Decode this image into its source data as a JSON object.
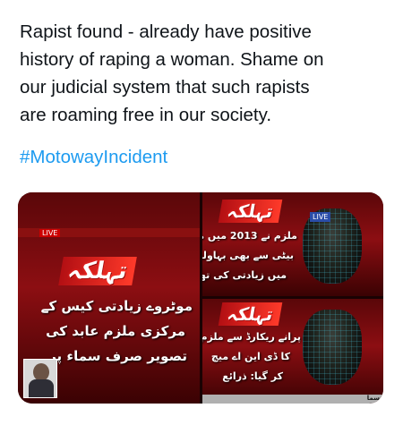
{
  "tweet": {
    "lines": [
      "Rapist found - already have positive",
      "history of raping a woman. Shame on",
      "our judicial system that such rapists",
      "are roaming free in our society."
    ],
    "hashtag": "#MotowayIncident"
  },
  "media": {
    "left": {
      "brand": "تہلکہ",
      "line1": "موٹروے زیادتی کیس کے",
      "line2": "مرکزی ملزم عابد کی",
      "line3": "تصویر صرف سماء پر",
      "live": "LIVE"
    },
    "top_right": {
      "brand": "تہلکہ",
      "line1": "ملزم نے 2013 میں ماں",
      "line2": "بیٹی سے بھی بہاولنگر",
      "line3": "میں زیادتی کی تھی",
      "chip": "LIVE"
    },
    "bottom_right": {
      "brand": "تہلکہ",
      "line1": "پرانے ریکارڈ سے ملزم",
      "line2": "کا ڈی این اے میچ",
      "line3": "کر گیا: ذرائع",
      "footer": "سما"
    }
  },
  "colors": {
    "text": "#0f1419",
    "hashtag": "#1d9bf0",
    "news_red": "#8c0e12"
  }
}
